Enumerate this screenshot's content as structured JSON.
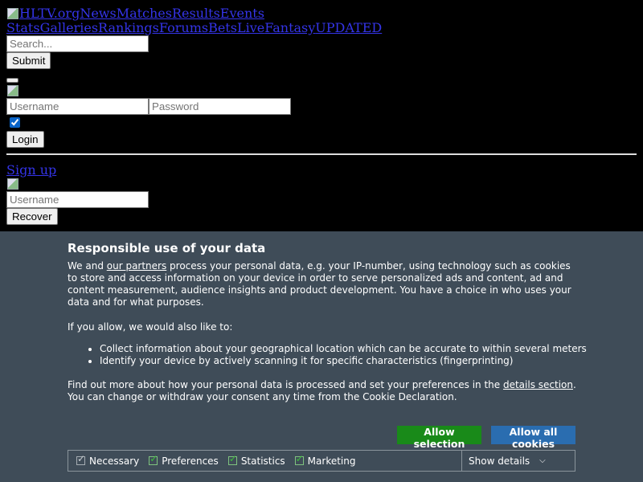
{
  "nav": {
    "logo_alt": "HLTV.org",
    "row1": [
      "News",
      "Matches",
      "Results",
      "Events"
    ],
    "row2": [
      "Stats",
      "Galleries",
      "Rankings",
      "Forums",
      "Bets",
      "Live",
      "Fantasy",
      "UPDATED"
    ]
  },
  "search": {
    "placeholder": "Search...",
    "submit_label": "Submit"
  },
  "login": {
    "username_placeholder": "Username",
    "password_placeholder": "Password",
    "login_label": "Login",
    "signup_label": "Sign up"
  },
  "recover": {
    "username_placeholder": "Username",
    "recover_label": "Recover"
  },
  "cookie": {
    "title": "Responsible use of your data",
    "p1_a": "We and ",
    "p1_link": "our partners",
    "p1_b": " process your personal data, e.g. your IP-number, using technology such as cookies to store and access information on your device in order to serve personalized ads and content, ad and content measurement, audience insights and product development. You have a choice in who uses your data and for what purposes.",
    "p2": "If you allow, we would also like to:",
    "bullets": [
      "Collect information about your geographical location which can be accurate to within several meters",
      "Identify your device by actively scanning it for specific characteristics (fingerprinting)"
    ],
    "p3_a": "Find out more about how your personal data is processed and set your preferences in the ",
    "p3_link": "details section",
    "p3_b": ". You can change or withdraw your consent any time from the Cookie Declaration.",
    "allow_selection": "Allow selection",
    "allow_all": "Allow all cookies",
    "prefs": [
      "Necessary",
      "Preferences",
      "Statistics",
      "Marketing"
    ],
    "show_details": "Show details"
  }
}
